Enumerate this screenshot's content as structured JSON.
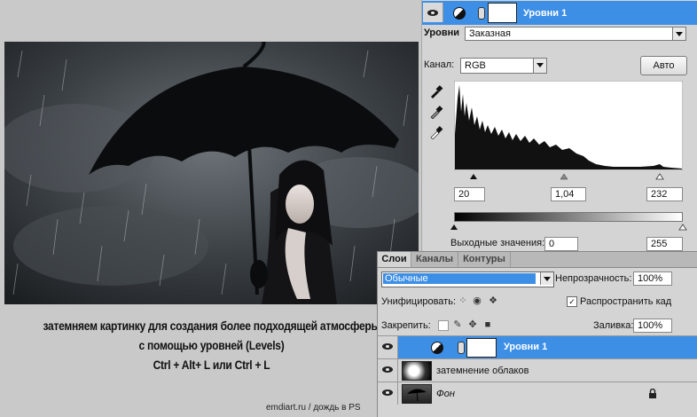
{
  "levels_panel": {
    "layer_name": "Уровни 1",
    "preset_label": "Уровни",
    "preset_value": "Заказная",
    "channel_label": "Канал:",
    "channel_value": "RGB",
    "auto_button": "Авто",
    "input_black": "20",
    "input_gamma": "1,04",
    "input_white": "232",
    "output_label": "Выходные значения:",
    "output_black": "0",
    "output_white": "255"
  },
  "layers_panel": {
    "tabs": [
      "Слои",
      "Каналы",
      "Контуры"
    ],
    "blend_mode": "Обычные",
    "opacity_label": "Непрозрачность:",
    "opacity_value": "100%",
    "unify_label": "Унифицировать:",
    "propagate_label": "Распространить кад",
    "lock_label": "Закрепить:",
    "fill_label": "Заливка:",
    "fill_value": "100%",
    "layers": [
      {
        "name": "Уровни 1",
        "selected": true
      },
      {
        "name": "затемнение облаков",
        "selected": false
      },
      {
        "name": "Фон",
        "selected": false
      }
    ]
  },
  "caption": {
    "line1": "затемняем картинку для создания более подходящей атмосферы",
    "line2": "с помощью уровней (Levels)",
    "line3": "Ctrl + Alt+ L  или Ctrl + L"
  },
  "footer": "emdiart.ru   / дождь в PS",
  "colors": {
    "selection": "#3d8fe6",
    "panel_bg": "#d4d4d4",
    "page_bg": "#c9c9c9"
  }
}
